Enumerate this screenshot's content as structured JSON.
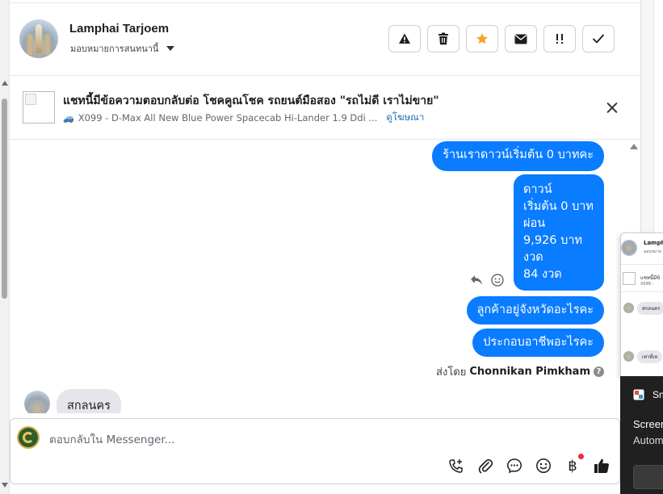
{
  "header": {
    "contact_name": "Lamphai Tarjoem",
    "assign_label": "มอบหมายการสนทนานี้",
    "actions": [
      {
        "name": "spam-button",
        "icon": "warning-icon"
      },
      {
        "name": "delete-button",
        "icon": "trash-icon"
      },
      {
        "name": "star-button",
        "icon": "star-icon",
        "color": "#f7a22b"
      },
      {
        "name": "unread-button",
        "icon": "envelope-icon"
      },
      {
        "name": "follow-up-button",
        "icon": "exclamation-icon"
      },
      {
        "name": "done-button",
        "icon": "checkmark-icon"
      }
    ]
  },
  "ad": {
    "title": "แชทนี้มีข้อความตอบกลับต่อ โชคคูณโชค รถยนต์มือสอง \"รถไม่ดี เราไม่ขาย\"",
    "subtitle": "X099 - D-Max All New Blue Power Spacecab Hi-Lander 1.9 Ddi ...",
    "link": "ดูโฆษณา",
    "car_icon": "car-icon"
  },
  "messages": {
    "m1": "ร้านเราดาวน์เริ่มต้น 0 บาทคะ",
    "m2_lines": [
      "ดาวน์",
      "เริ่มต้น 0 บาท",
      "ผ่อน",
      "9,926 บาท",
      "งวด",
      "84 งวด"
    ],
    "m3": "ลูกค้าอยู่จังหวัดอะไรคะ",
    "m4": "ประกอบอาชีพอะไรคะ",
    "sent_by_prefix": "ส่งโดย",
    "sent_by_name": "Chonnikan Pimkham",
    "incoming": "สกลนคร",
    "bubble_color": "#0a7cff"
  },
  "composer": {
    "placeholder": "ตอบกลับใน Messenger...",
    "tools": [
      "call-plus-icon",
      "paperclip-icon",
      "chat-icon",
      "emoji-icon",
      "baht-icon",
      "thumbs-up-icon"
    ],
    "baht_symbol": "฿"
  },
  "preview": {
    "name": "Lamphai",
    "sub": "มอบหมาย",
    "ad": "แชทนี้มีข้",
    "ad_sub": "X099 -",
    "bubble1": "สกลนคร",
    "bubble2": "เท่าที่เห"
  },
  "toast": {
    "app": "Sn",
    "title": "Screen",
    "body": "Autom"
  }
}
